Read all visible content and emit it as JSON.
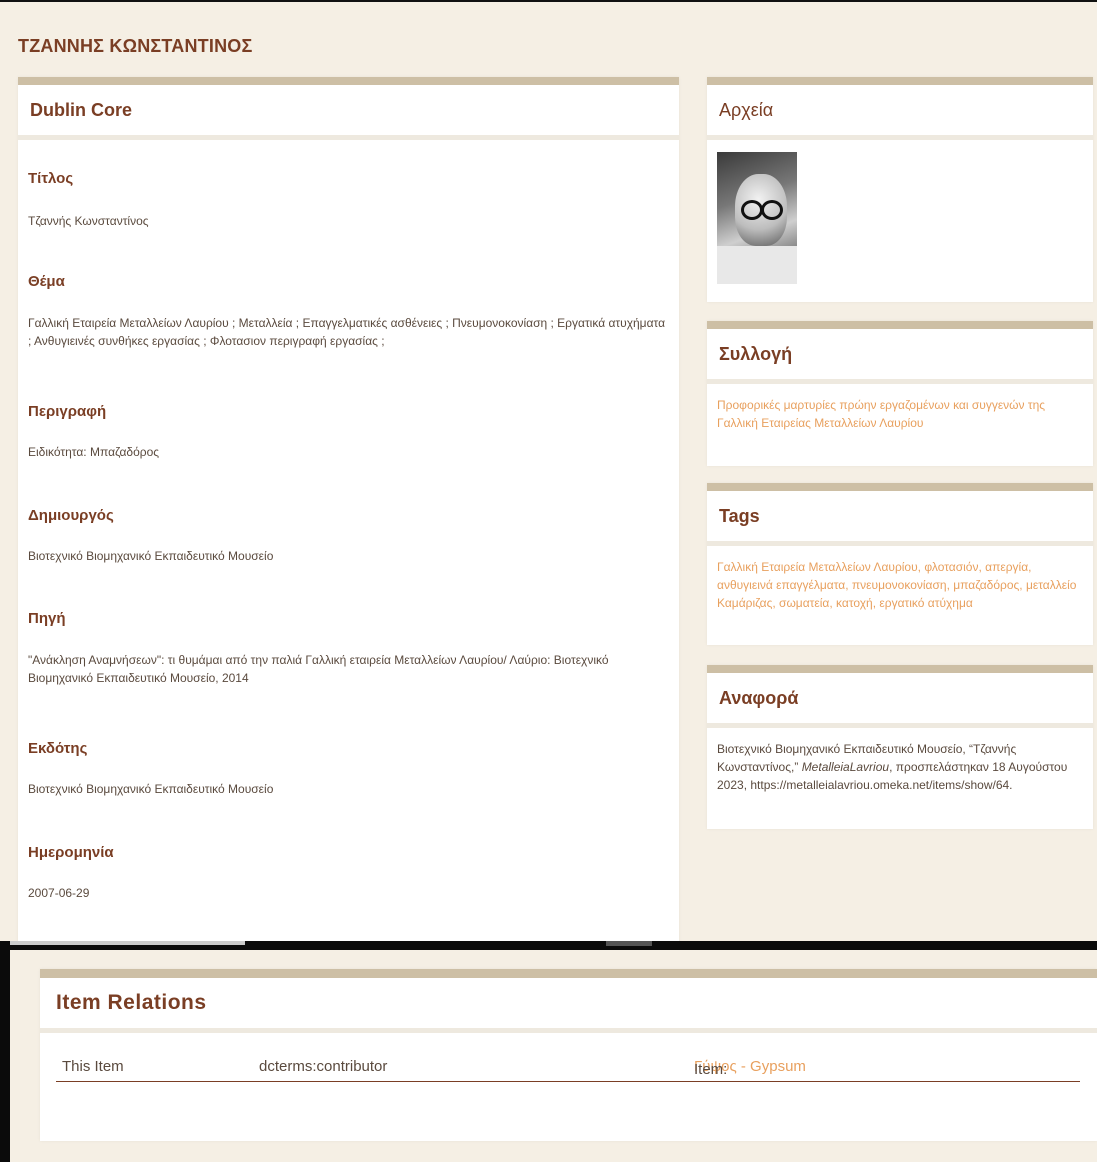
{
  "item": {
    "title": "ΤΖΑΝΝΗΣ ΚΩΝΣΤΑΝΤΙΝΟΣ"
  },
  "dublin_core": {
    "heading": "Dublin Core",
    "fields": [
      {
        "label": "Τίτλος",
        "value": "Τζαννής Κωνσταντίνος"
      },
      {
        "label": "Θέμα",
        "value": "Γαλλική Εταιρεία Μεταλλείων Λαυρίου ; Μεταλλεία ; Επαγγελματικές ασθένειες ; Πνευμονοκονίαση ; Εργατικά ατυχήματα ; Ανθυγιεινές συνθήκες εργασίας ; Φλοτασιον περιγραφή εργασίας ;"
      },
      {
        "label": "Περιγραφή",
        "value": "Ειδικότητα: Μπαζαδόρος"
      },
      {
        "label": "Δημιουργός",
        "value": "Βιοτεχνικό Βιομηχανικό Εκπαιδευτικό Μουσείο"
      },
      {
        "label": "Πηγή",
        "value": "\"Ανάκληση Αναμνήσεων\": τι θυμάμαι από την παλιά Γαλλική εταιρεία Μεταλλείων Λαυρίου/ Λαύριο: Βιοτεχνικό Βιομηχανικό Εκπαιδευτικό Μουσείο, 2014"
      },
      {
        "label": "Εκδότης",
        "value": "Βιοτεχνικό Βιομηχανικό Εκπαιδευτικό Μουσείο"
      },
      {
        "label": "Ημερομηνία",
        "value": "2007-06-29"
      }
    ]
  },
  "sidebar": {
    "files": {
      "heading": "Αρχεία"
    },
    "collection": {
      "heading": "Συλλογή",
      "link": "Προφορικές μαρτυρίες πρώην εργαζομένων και συγγενών της Γαλλική Εταιρείας Μεταλλείων Λαυρίου"
    },
    "tags": {
      "heading": "Tags",
      "items": [
        "Γαλλική Εταιρεία Μεταλλείων Λαυρίου",
        "φλοτασιόν",
        "απεργία",
        "ανθυγιεινά επαγγέλματα",
        "πνευμονοκονίαση",
        "μπαζαδόρος",
        "μεταλλείο Καμάριζας",
        "σωματεία",
        "κατοχή",
        "εργατικό ατύχημα"
      ]
    },
    "citation": {
      "heading": "Αναφορά",
      "part1": "Βιοτεχνικό Βιομηχανικό Εκπαιδευτικό Μουσείο, “Τζαννής Κωνσταντίνος,”",
      "site": "MetalleiaLavriou",
      "part2": ", προσπελάστηκαν 18 Αυγούστου 2023,",
      "url": "https://metalleialavriou.omeka.net/items/show/64."
    }
  },
  "relations": {
    "heading": "Item Relations",
    "row": {
      "subject": "This Item",
      "predicate": "dcterms:contributor",
      "object_prefix": "Item: ",
      "object_link": "Γύψος - Gypsum"
    }
  }
}
